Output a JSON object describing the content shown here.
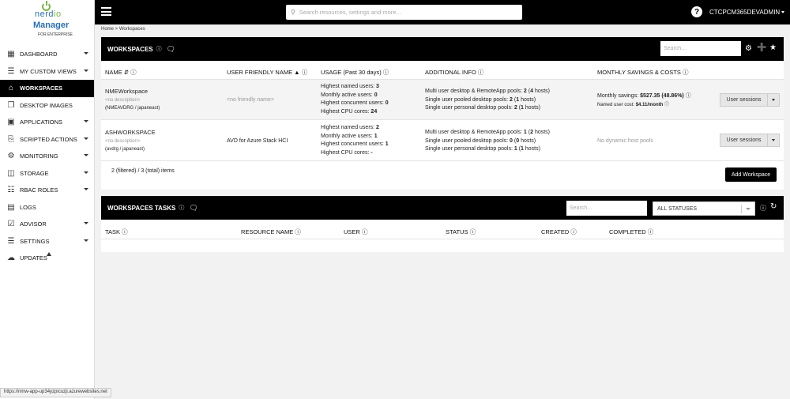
{
  "logo": {
    "brand1a": "nerd",
    "brand1b": "io",
    "brand2": "Manager",
    "brand3": "FOR ENTERPRISE"
  },
  "sidebar": {
    "items": [
      {
        "label": "DASHBOARD",
        "icon": "dashboard-icon"
      },
      {
        "label": "MY CUSTOM VIEWS",
        "icon": "custom-views-icon"
      },
      {
        "label": "WORKSPACES",
        "icon": "workspaces-icon"
      },
      {
        "label": "DESKTOP IMAGES",
        "icon": "desktop-images-icon"
      },
      {
        "label": "APPLICATIONS",
        "icon": "applications-icon"
      },
      {
        "label": "SCRIPTED ACTIONS",
        "icon": "scripted-actions-icon"
      },
      {
        "label": "MONITORING",
        "icon": "monitoring-icon"
      },
      {
        "label": "STORAGE",
        "icon": "storage-icon"
      },
      {
        "label": "RBAC ROLES",
        "icon": "rbac-icon"
      },
      {
        "label": "LOGS",
        "icon": "logs-icon"
      },
      {
        "label": "ADVISOR",
        "icon": "advisor-icon"
      },
      {
        "label": "SETTINGS",
        "icon": "settings-icon"
      },
      {
        "label": "UPDATES",
        "icon": "updates-icon"
      }
    ]
  },
  "topbar": {
    "search_placeholder": "Search resources, settings and more...",
    "help": "?",
    "user": "CTCPCM365DEVADMIN"
  },
  "breadcrumb": "Home  >  Workspaces",
  "workspaces": {
    "title": "WORKSPACES",
    "search_placeholder": "Search...",
    "columns": {
      "name": "NAME",
      "friendly": "USER FRIENDLY NAME",
      "usage": "USAGE (Past 30 days)",
      "info": "ADDITIONAL INFO",
      "savings": "MONTHLY SAVINGS & COSTS"
    },
    "rows": [
      {
        "name": "NMEWorkspace",
        "desc": "<no description>",
        "rg": "(NMEAVDRG / japaneast)",
        "friendly": "<no friendly name>",
        "usage": [
          {
            "label": "Highest named users: ",
            "value": "3"
          },
          {
            "label": "Monthly active users: ",
            "value": "0"
          },
          {
            "label": "Highest concurrent users: ",
            "value": "0"
          },
          {
            "label": "Highest CPU cores: ",
            "value": "24"
          }
        ],
        "info": [
          {
            "label": "Multi user desktop & RemoteApp pools: ",
            "n": "2",
            "mid": " (",
            "h": "4",
            "end": " hosts)"
          },
          {
            "label": "Single user pooled desktop pools: ",
            "n": "2",
            "mid": " (",
            "h": "1",
            "end": " hosts)"
          },
          {
            "label": "Single user personal desktop pools: ",
            "n": "2",
            "mid": " (",
            "h": "1",
            "end": " hosts)"
          }
        ],
        "savings_label": "Monthly savings: ",
        "savings_value": "$527.35 (48.86%)",
        "cost_label": "Named user cost: ",
        "cost_value": "$4.11/month",
        "button": "User sessions"
      },
      {
        "name": "ASHWORKSPACE",
        "desc": "<no description>",
        "rg": "(avdrg / japaneast)",
        "friendly": "AVD for Azure Stack HCI",
        "usage": [
          {
            "label": "Highest named users: ",
            "value": "2"
          },
          {
            "label": "Monthly active users: ",
            "value": "1"
          },
          {
            "label": "Highest concurrent users: ",
            "value": "1"
          },
          {
            "label": "Highest CPU cores: ",
            "value": "-"
          }
        ],
        "info": [
          {
            "label": "Multi user desktop & RemoteApp pools: ",
            "n": "1",
            "mid": " (",
            "h": "2",
            "end": " hosts)"
          },
          {
            "label": "Single user pooled desktop pools: ",
            "n": "0",
            "mid": " (",
            "h": "0",
            "end": " hosts)"
          },
          {
            "label": "Single user personal desktop pools: ",
            "n": "1",
            "mid": " (",
            "h": "1",
            "end": " hosts)"
          }
        ],
        "savings_text": "No dynamic host pools",
        "button": "User sessions"
      }
    ],
    "count": "2 (filtered) / 3 (total) items",
    "add_button": "Add Workspace"
  },
  "tasks": {
    "title": "WORKSPACES TASKS",
    "search_placeholder": "Search...",
    "status_filter": "ALL STATUSES",
    "columns": {
      "task": "TASK",
      "resource": "RESOURCE NAME",
      "user": "USER",
      "status": "STATUS",
      "created": "CREATED",
      "completed": "COMPLETED"
    }
  },
  "status_bar": "https://nmw-app-up34yzpicuzji.azurewebsites.net"
}
